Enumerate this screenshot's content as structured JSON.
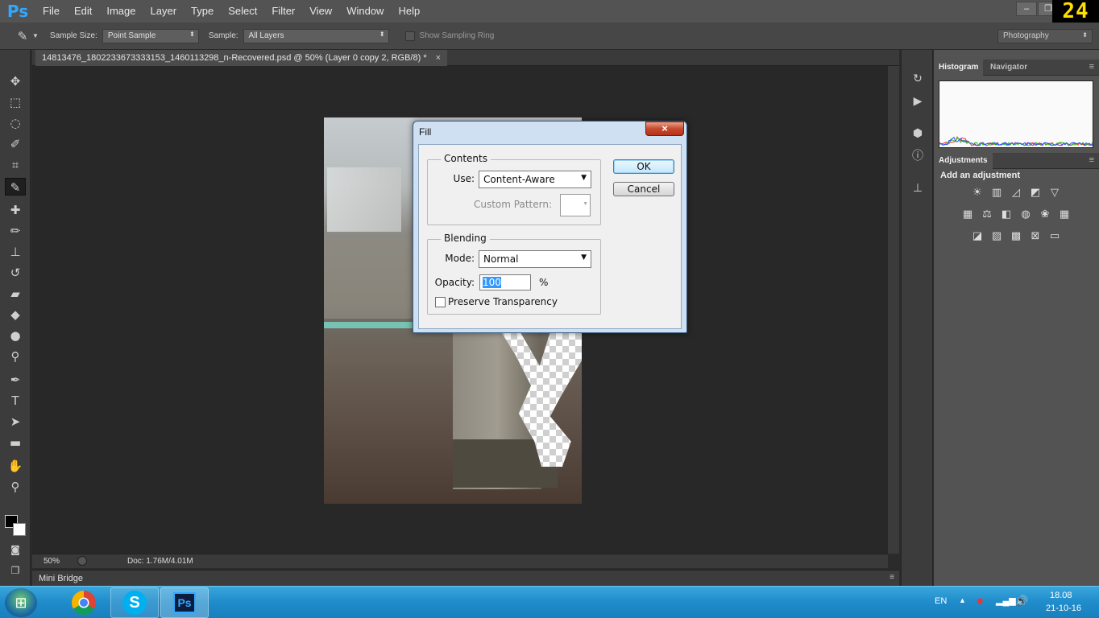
{
  "app": {
    "logo": "Ps",
    "menu": [
      "File",
      "Edit",
      "Image",
      "Layer",
      "Type",
      "Select",
      "Filter",
      "View",
      "Window",
      "Help"
    ],
    "counter": "24",
    "minimize": "–",
    "restore": "❐"
  },
  "options_bar": {
    "sample_size_label": "Sample Size:",
    "sample_size_value": "Point Sample",
    "sample_label": "Sample:",
    "sample_value": "All Layers",
    "show_ring_label": "Show Sampling Ring",
    "workspace": "Photography"
  },
  "document": {
    "tab_title": "14813476_1802233673333153_1460113298_n-Recovered.psd @ 50% (Layer 0 copy 2, RGB/8) *",
    "tab_close": "×",
    "zoom": "50%",
    "doc_info": "Doc: 1.76M/4.01M"
  },
  "mini_bridge": {
    "label": "Mini Bridge"
  },
  "panels": {
    "tabs_top": [
      "Histogram",
      "Navigator"
    ],
    "tabs_adjust": [
      "Adjustments"
    ],
    "add_adjustment": "Add an adjustment"
  },
  "histogram": {
    "colors": {
      "red": "#ff2a2a",
      "green": "#22c422",
      "blue": "#2a4dff"
    }
  },
  "fill_dialog": {
    "title": "Fill",
    "close": "×",
    "contents_title": "Contents",
    "use_label": "Use:",
    "use_value": "Content-Aware",
    "custom_pattern_label": "Custom Pattern:",
    "blending_title": "Blending",
    "mode_label": "Mode:",
    "mode_value": "Normal",
    "opacity_label": "Opacity:",
    "opacity_value": "100",
    "opacity_unit": "%",
    "preserve_label": "Preserve Transparency",
    "ok": "OK",
    "cancel": "Cancel"
  },
  "taskbar": {
    "lang": "EN",
    "time": "18.08",
    "date": "21-10-16",
    "ps_label": "Ps"
  }
}
